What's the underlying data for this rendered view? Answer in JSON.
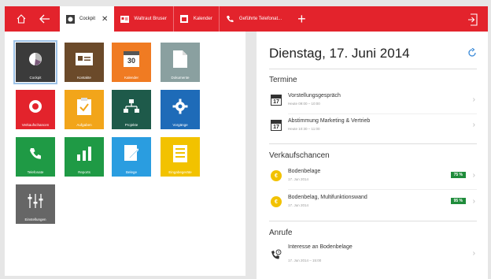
{
  "topbar": {
    "tabs": [
      {
        "label": "Cockpit",
        "active": true,
        "close": "✕"
      },
      {
        "label": "Waltraut Bruser",
        "active": false
      },
      {
        "label": "Kalender",
        "active": false
      },
      {
        "label": "Geführte Telefonat...",
        "active": false
      }
    ],
    "plus": "+"
  },
  "tiles": [
    {
      "label": "Cockpit",
      "color": "#3b3b3b",
      "icon": "pie-chart-icon"
    },
    {
      "label": "Kontakte",
      "color": "#6b4a2a",
      "icon": "contact-card-icon"
    },
    {
      "label": "Kalender",
      "color": "#f07b22",
      "icon": "calendar-icon",
      "icon_text": "30"
    },
    {
      "label": "Dokumente",
      "color": "#8aa0a0",
      "icon": "document-icon"
    },
    {
      "label": "Verkaufschancen",
      "color": "#e3232c",
      "icon": "coin-icon"
    },
    {
      "label": "Aufgaben",
      "color": "#f2a51a",
      "icon": "clipboard-icon"
    },
    {
      "label": "Projekte",
      "color": "#1e5a4a",
      "icon": "org-chart-icon"
    },
    {
      "label": "Vorgänge",
      "color": "#1e6bb8",
      "icon": "gear-icon"
    },
    {
      "label": "Telefonate",
      "color": "#1f9a45",
      "icon": "phone-icon"
    },
    {
      "label": "Reports",
      "color": "#1f9a45",
      "icon": "bar-chart-icon"
    },
    {
      "label": "Belege",
      "color": "#2a9de0",
      "icon": "receipt-icon"
    },
    {
      "label": "Eingabegeräte",
      "color": "#f2c200",
      "icon": "device-icon"
    },
    {
      "label": "Einstellungen",
      "color": "#666666",
      "icon": "sliders-icon"
    }
  ],
  "right": {
    "date": "Dienstag, 17. Juni 2014",
    "sections": {
      "termine": {
        "title": "Termine",
        "items": [
          {
            "title": "Vorstellungsgespräch",
            "sub": "Heute 09:00 – 10:00",
            "icon_num": "17"
          },
          {
            "title": "Abstimmung Marketing & Vertrieb",
            "sub": "Heute 10:30 – 11:00",
            "icon_num": "17"
          }
        ]
      },
      "verkaufschancen": {
        "title": "Verkaufschancen",
        "items": [
          {
            "title": "Bodenbelage",
            "sub": "17. Jun 2014",
            "pct": "75 %"
          },
          {
            "title": "Bodenbelag, Multifunktionswand",
            "sub": "17. Jun 2014",
            "pct": "95 %"
          }
        ]
      },
      "anrufe": {
        "title": "Anrufe",
        "items": [
          {
            "title": "Interesse an Bodenbelage",
            "sub": "17. Jun 2014 – 15:00"
          }
        ]
      }
    },
    "chevron": "›"
  }
}
